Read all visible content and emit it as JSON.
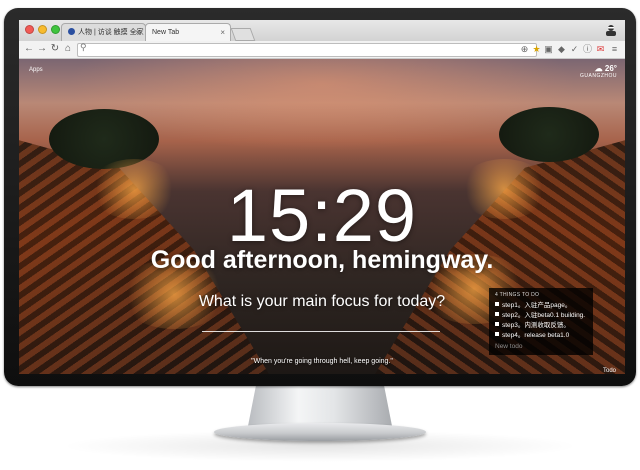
{
  "browser": {
    "tabs": [
      {
        "label": "人物 | 访谈 触摸 全家 暖在"
      },
      {
        "label": "New Tab"
      }
    ],
    "omnibox": {
      "value": ""
    }
  },
  "dashboard": {
    "apps_label": "Apps",
    "weather": {
      "temp": "26°",
      "city": "GUANGZHOU"
    },
    "time": "15:29",
    "greeting": "Good afternoon, hemingway.",
    "focus_question": "What is your main focus for today?",
    "quote": "\"When you're going through hell, keep going.\"",
    "todo": {
      "title": "4 THINGS TO DO",
      "items": [
        {
          "text": "step1。入驻产品page。"
        },
        {
          "text": "step2。入驻beta0.1 building."
        },
        {
          "text": "step3。内测收取反馈。"
        },
        {
          "text": "step4。release beta1.0"
        }
      ],
      "new_placeholder": "New todo",
      "toggle_label": "Todo"
    }
  },
  "colors": {
    "traffic_red": "#f25a55",
    "traffic_yellow": "#f8bb2d",
    "traffic_green": "#3fc43e"
  },
  "icons": {
    "back": "back-arrow-icon",
    "forward": "forward-arrow-icon",
    "reload": "reload-icon",
    "home": "home-icon",
    "search": "search-icon",
    "star": "star-icon",
    "cloud": "cloud-icon"
  }
}
